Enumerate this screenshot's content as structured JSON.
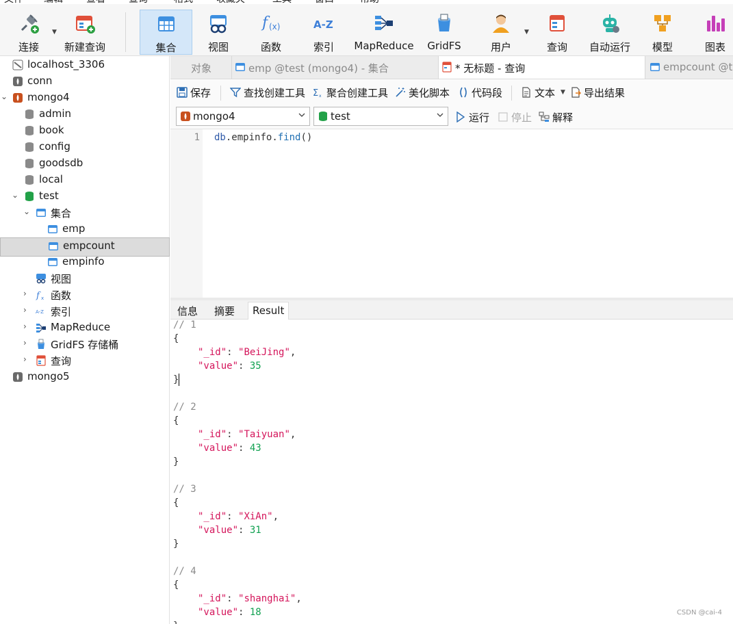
{
  "menu": [
    "文件",
    "编辑",
    "查看",
    "查询",
    "格式",
    "收藏夹",
    "工具",
    "窗口",
    "帮助"
  ],
  "ribbon": {
    "connect": "连接",
    "new_query": "新建查询",
    "collection": "集合",
    "view": "视图",
    "function": "函数",
    "index": "索引",
    "mapreduce": "MapReduce",
    "gridfs": "GridFS",
    "user": "用户",
    "query": "查询",
    "automation": "自动运行",
    "model": "模型",
    "chart": "图表"
  },
  "tree": {
    "items": [
      {
        "label": "localhost_3306"
      },
      {
        "label": "conn"
      },
      {
        "label": "mongo4"
      },
      {
        "label": "admin"
      },
      {
        "label": "book"
      },
      {
        "label": "config"
      },
      {
        "label": "goodsdb"
      },
      {
        "label": "local"
      },
      {
        "label": "test"
      },
      {
        "label": "集合"
      },
      {
        "label": "emp"
      },
      {
        "label": "empcount"
      },
      {
        "label": "empinfo"
      },
      {
        "label": "视图"
      },
      {
        "label": "函数"
      },
      {
        "label": "索引"
      },
      {
        "label": "MapReduce"
      },
      {
        "label": "GridFS 存储桶"
      },
      {
        "label": "查询"
      },
      {
        "label": "mongo5"
      }
    ]
  },
  "tabs": [
    {
      "label": "对象"
    },
    {
      "label": "emp @test (mongo4) - 集合"
    },
    {
      "label": "* 无标题 - 查询"
    },
    {
      "label": "empcount @test"
    }
  ],
  "toolbar": {
    "save": "保存",
    "find_builder": "查找创建工具",
    "agg_builder": "聚合创建工具",
    "beautify": "美化脚本",
    "snippet": "代码段",
    "text": "文本",
    "export": "导出结果"
  },
  "selectors": {
    "connection": "mongo4",
    "database": "test",
    "run": "运行",
    "stop": "停止",
    "explain": "解释"
  },
  "editor": {
    "line_no": "1",
    "code_db": "db",
    "code_dot1": ".",
    "code_coll": "empinfo",
    "code_dot2": ".",
    "code_fn": "find",
    "code_paren": "()"
  },
  "result_tabs": [
    "信息",
    "摘要",
    "Result"
  ],
  "results": [
    {
      "header": "// 1",
      "id": "\"BeiJing\"",
      "value": "35"
    },
    {
      "header": "// 2",
      "id": "\"Taiyuan\"",
      "value": "43"
    },
    {
      "header": "// 3",
      "id": "\"XiAn\"",
      "value": "31"
    },
    {
      "header": "// 4",
      "id": "\"shanghai\"",
      "value": "18"
    }
  ],
  "result_syntax": {
    "open": "{",
    "close": "}",
    "id_key": "\"_id\"",
    "value_key": "\"value\"",
    "colon": ": ",
    "comma": ","
  },
  "watermark": "CSDN @cai-4",
  "colors": {
    "accent": "#d4e7f9",
    "key": "#d4145a",
    "number": "#10a050",
    "selected_row": "#dcdcdc"
  }
}
